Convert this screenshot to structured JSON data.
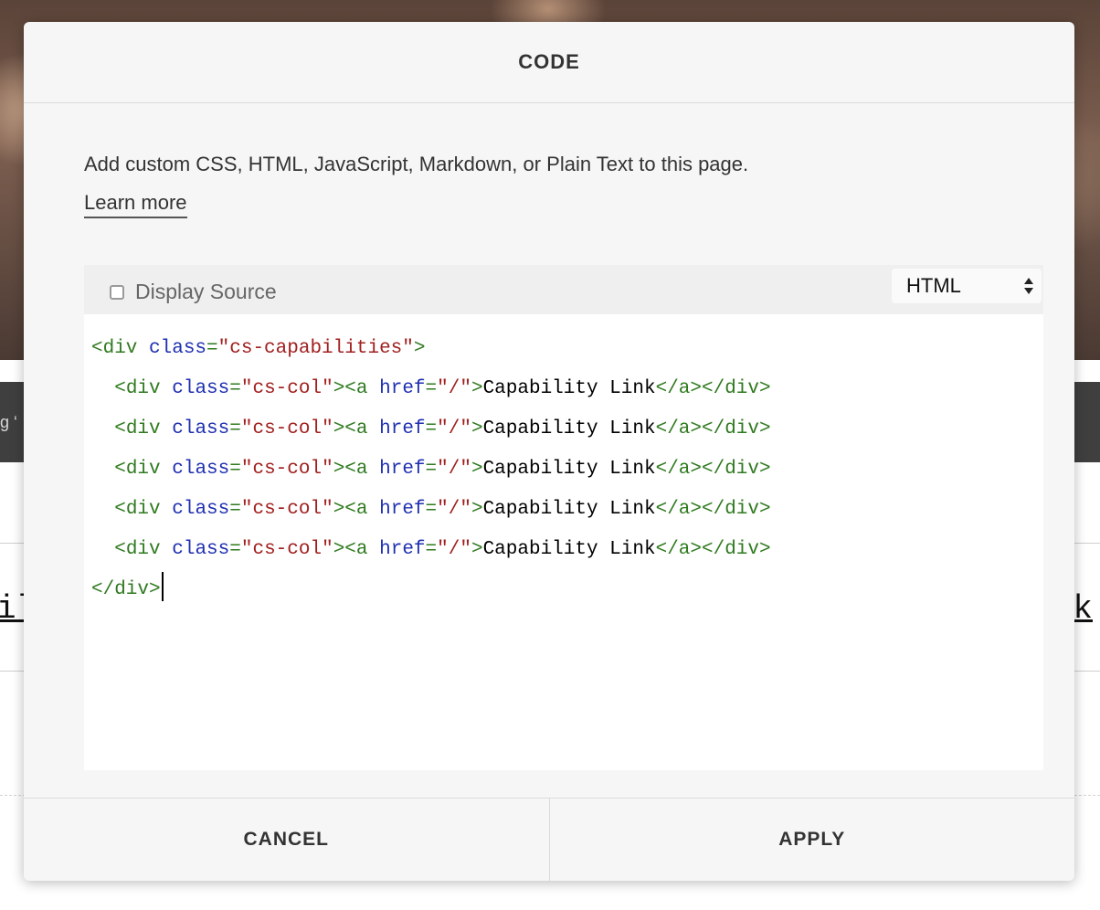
{
  "background": {
    "darkbar_text": "g ‘",
    "link_left": "il",
    "link_right": "k"
  },
  "modal": {
    "title": "CODE",
    "description": "Add custom CSS, HTML, JavaScript, Markdown, or Plain Text to this page.",
    "learn_more": "Learn more",
    "display_source_label": "Display Source",
    "display_source_checked": false,
    "mode": "HTML",
    "code_lines": [
      [
        [
          "tag",
          "<div "
        ],
        [
          "attr",
          "class"
        ],
        [
          "tag",
          "="
        ],
        [
          "str",
          "\"cs-capabilities\""
        ],
        [
          "tag",
          ">"
        ]
      ],
      [
        [
          "text",
          "  "
        ],
        [
          "tag",
          "<div "
        ],
        [
          "attr",
          "class"
        ],
        [
          "tag",
          "="
        ],
        [
          "str",
          "\"cs-col\""
        ],
        [
          "tag",
          "><a "
        ],
        [
          "attr",
          "href"
        ],
        [
          "tag",
          "="
        ],
        [
          "str",
          "\"/\""
        ],
        [
          "tag",
          ">"
        ],
        [
          "text",
          "Capability Link"
        ],
        [
          "tag",
          "</a></div>"
        ]
      ],
      [
        [
          "text",
          "  "
        ],
        [
          "tag",
          "<div "
        ],
        [
          "attr",
          "class"
        ],
        [
          "tag",
          "="
        ],
        [
          "str",
          "\"cs-col\""
        ],
        [
          "tag",
          "><a "
        ],
        [
          "attr",
          "href"
        ],
        [
          "tag",
          "="
        ],
        [
          "str",
          "\"/\""
        ],
        [
          "tag",
          ">"
        ],
        [
          "text",
          "Capability Link"
        ],
        [
          "tag",
          "</a></div>"
        ]
      ],
      [
        [
          "text",
          "  "
        ],
        [
          "tag",
          "<div "
        ],
        [
          "attr",
          "class"
        ],
        [
          "tag",
          "="
        ],
        [
          "str",
          "\"cs-col\""
        ],
        [
          "tag",
          "><a "
        ],
        [
          "attr",
          "href"
        ],
        [
          "tag",
          "="
        ],
        [
          "str",
          "\"/\""
        ],
        [
          "tag",
          ">"
        ],
        [
          "text",
          "Capability Link"
        ],
        [
          "tag",
          "</a></div>"
        ]
      ],
      [
        [
          "text",
          "  "
        ],
        [
          "tag",
          "<div "
        ],
        [
          "attr",
          "class"
        ],
        [
          "tag",
          "="
        ],
        [
          "str",
          "\"cs-col\""
        ],
        [
          "tag",
          "><a "
        ],
        [
          "attr",
          "href"
        ],
        [
          "tag",
          "="
        ],
        [
          "str",
          "\"/\""
        ],
        [
          "tag",
          ">"
        ],
        [
          "text",
          "Capability Link"
        ],
        [
          "tag",
          "</a></div>"
        ]
      ],
      [
        [
          "text",
          "  "
        ],
        [
          "tag",
          "<div "
        ],
        [
          "attr",
          "class"
        ],
        [
          "tag",
          "="
        ],
        [
          "str",
          "\"cs-col\""
        ],
        [
          "tag",
          "><a "
        ],
        [
          "attr",
          "href"
        ],
        [
          "tag",
          "="
        ],
        [
          "str",
          "\"/\""
        ],
        [
          "tag",
          ">"
        ],
        [
          "text",
          "Capability Link"
        ],
        [
          "tag",
          "</a></div>"
        ]
      ],
      [
        [
          "tag",
          "</div>"
        ]
      ]
    ],
    "cancel_label": "CANCEL",
    "apply_label": "APPLY"
  },
  "colors": {
    "tag": "#2f7a1f",
    "attr": "#1f2fb0",
    "string": "#a11f1f",
    "text": "#000000"
  }
}
